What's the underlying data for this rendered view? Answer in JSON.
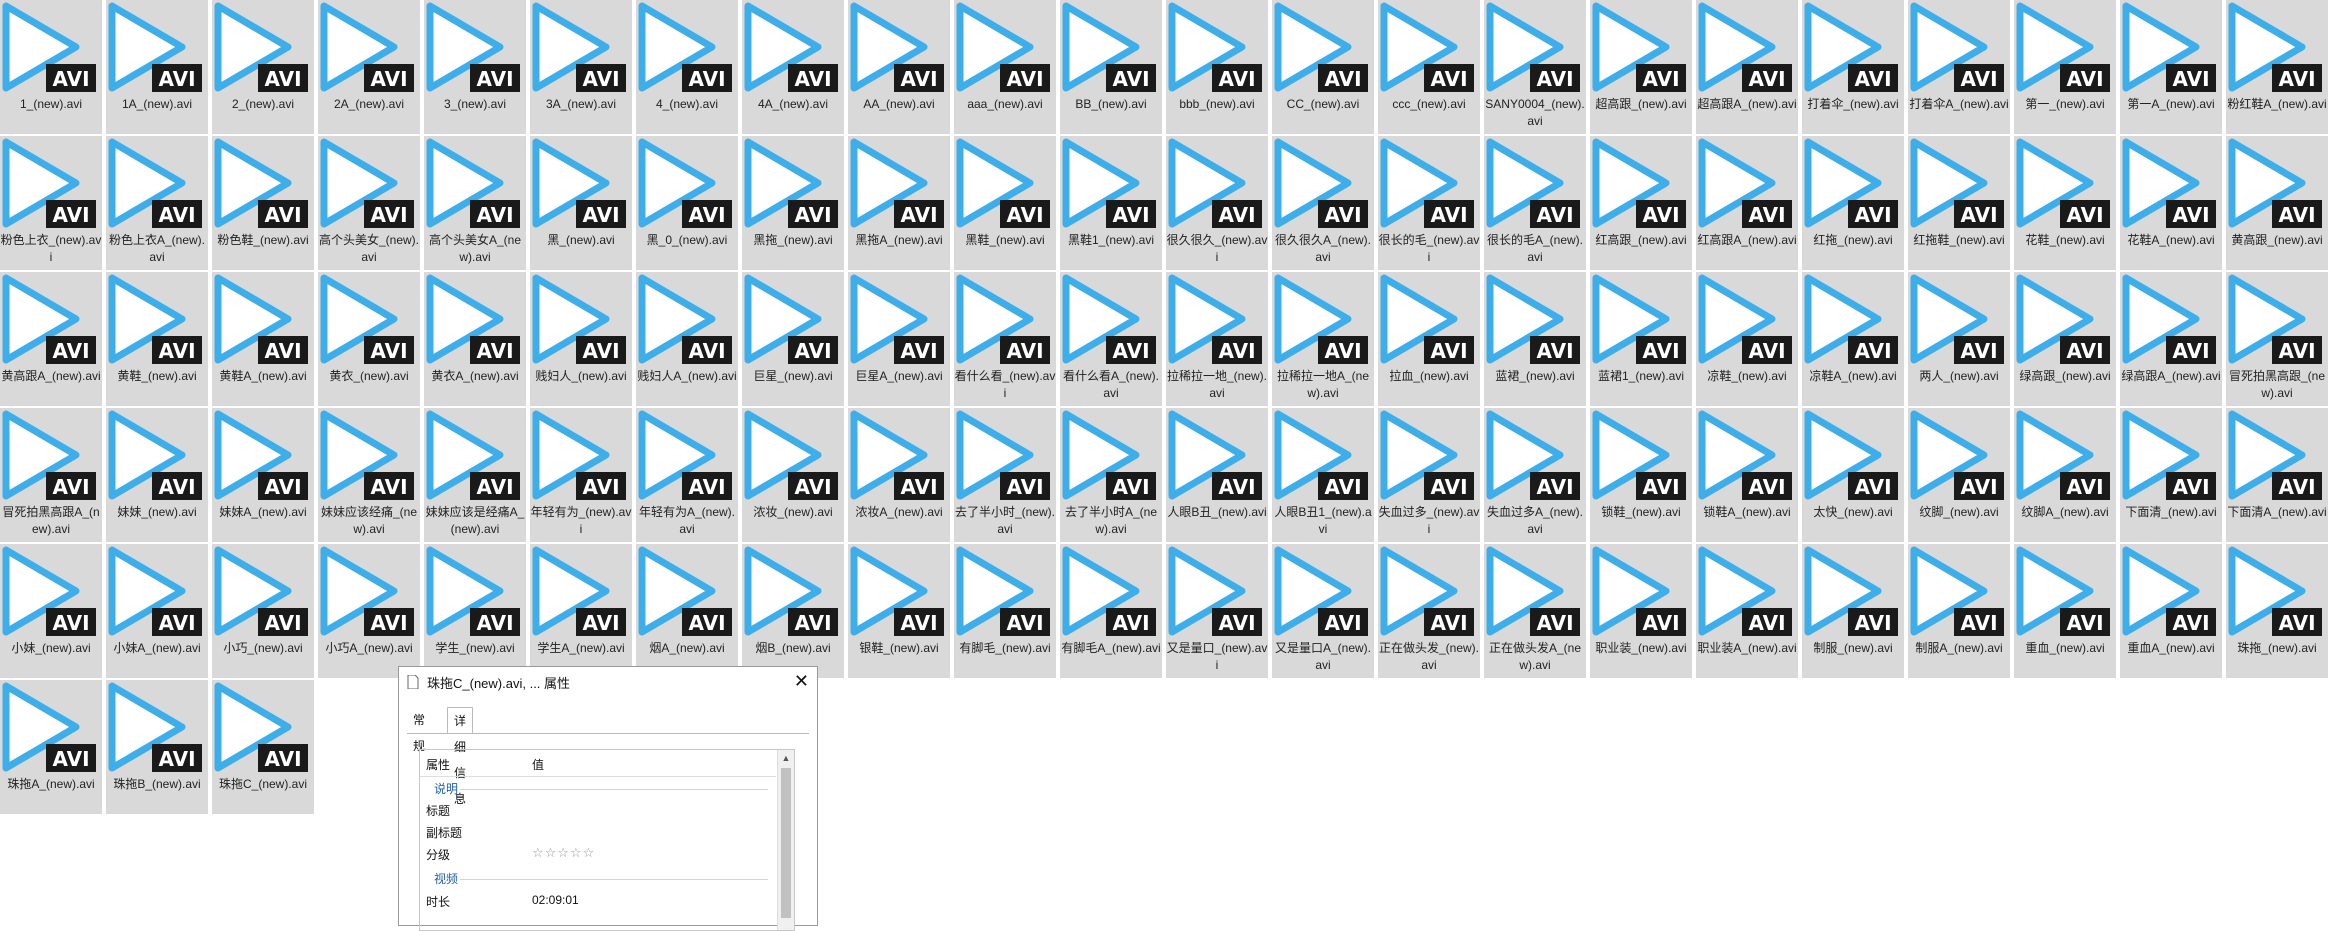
{
  "files": [
    [
      "1_(new).avi",
      "1A_(new).avi",
      "2_(new).avi",
      "2A_(new).avi",
      "3_(new).avi",
      "3A_(new).avi",
      "4_(new).avi",
      "4A_(new).avi",
      "AA_(new).avi",
      "aaa_(new).avi",
      "BB_(new).avi",
      "bbb_(new).avi",
      "CC_(new).avi",
      "ccc_(new).avi",
      "SANY0004_(new).avi",
      "超高跟_(new).avi",
      "超高跟A_(new).avi",
      "打着伞_(new).avi",
      "打着伞A_(new).avi",
      "第一_(new).avi",
      "第一A_(new).avi",
      "粉红鞋A_(new).avi"
    ],
    [
      "粉色上衣_(new).avi",
      "粉色上衣A_(new).avi",
      "粉色鞋_(new).avi",
      "高个头美女_(new).avi",
      "高个头美女A_(new).avi",
      "黑_(new).avi",
      "黑_0_(new).avi",
      "黑拖_(new).avi",
      "黑拖A_(new).avi",
      "黑鞋_(new).avi",
      "黑鞋1_(new).avi",
      "很久很久_(new).avi",
      "很久很久A_(new).avi",
      "很长的毛_(new).avi",
      "很长的毛A_(new).avi",
      "红高跟_(new).avi",
      "红高跟A_(new).avi",
      "红拖_(new).avi",
      "红拖鞋_(new).avi",
      "花鞋_(new).avi",
      "花鞋A_(new).avi",
      "黄高跟_(new).avi"
    ],
    [
      "黄高跟A_(new).avi",
      "黄鞋_(new).avi",
      "黄鞋A_(new).avi",
      "黄衣_(new).avi",
      "黄衣A_(new).avi",
      "贱妇人_(new).avi",
      "贱妇人A_(new).avi",
      "巨星_(new).avi",
      "巨星A_(new).avi",
      "看什么看_(new).avi",
      "看什么看A_(new).avi",
      "拉稀拉一地_(new).avi",
      "拉稀拉一地A_(new).avi",
      "拉血_(new).avi",
      "蓝裙_(new).avi",
      "蓝裙1_(new).avi",
      "凉鞋_(new).avi",
      "凉鞋A_(new).avi",
      "两人_(new).avi",
      "绿高跟_(new).avi",
      "绿高跟A_(new).avi",
      "冒死拍黑高跟_(new).avi"
    ],
    [
      "冒死拍黑高跟A_(new).avi",
      "妹妹_(new).avi",
      "妹妹A_(new).avi",
      "妹妹应该经痛_(new).avi",
      "妹妹应该是经痛A_(new).avi",
      "年轻有为_(new).avi",
      "年轻有为A_(new).avi",
      "浓妆_(new).avi",
      "浓妆A_(new).avi",
      "去了半小时_(new).avi",
      "去了半小时A_(new).avi",
      "人眼B丑_(new).avi",
      "人眼B丑1_(new).avi",
      "失血过多_(new).avi",
      "失血过多A_(new).avi",
      "锁鞋_(new).avi",
      "锁鞋A_(new).avi",
      "太快_(new).avi",
      "纹脚_(new).avi",
      "纹脚A_(new).avi",
      "下面清_(new).avi",
      "下面清A_(new).avi"
    ],
    [
      "小妹_(new).avi",
      "小妹A_(new).avi",
      "小巧_(new).avi",
      "小巧A_(new).avi",
      "学生_(new).avi",
      "学生A_(new).avi",
      "烟A_(new).avi",
      "烟B_(new).avi",
      "银鞋_(new).avi",
      "有脚毛_(new).avi",
      "有脚毛A_(new).avi",
      "又是量口_(new).avi",
      "又是量口A_(new).avi",
      "正在做头发_(new).avi",
      "正在做头发A_(new).avi",
      "职业装_(new).avi",
      "职业装A_(new).avi",
      "制服_(new).avi",
      "制服A_(new).avi",
      "重血_(new).avi",
      "重血A_(new).avi",
      "珠拖_(new).avi"
    ],
    [
      "珠拖A_(new).avi",
      "珠拖B_(new).avi",
      "珠拖C_(new).avi"
    ]
  ],
  "badge": "AVI",
  "colors": {
    "tile": "#d9d9d9",
    "play": "#3daee9",
    "badge_bg": "#1a1a1a",
    "badge_text": "#ffffff"
  },
  "dialog": {
    "title": "珠拖C_(new).avi, ... 属性",
    "tabs": [
      "常规",
      "详细信息"
    ],
    "active_tab": "详细信息",
    "column_property": "属性",
    "column_value": "值",
    "section_description": "说明",
    "label_title": "标题",
    "label_subtitle": "副标题",
    "label_rating": "分级",
    "rating_stars": "☆☆☆☆☆",
    "section_video": "视频",
    "label_duration": "时长",
    "duration": "02:09:01"
  }
}
